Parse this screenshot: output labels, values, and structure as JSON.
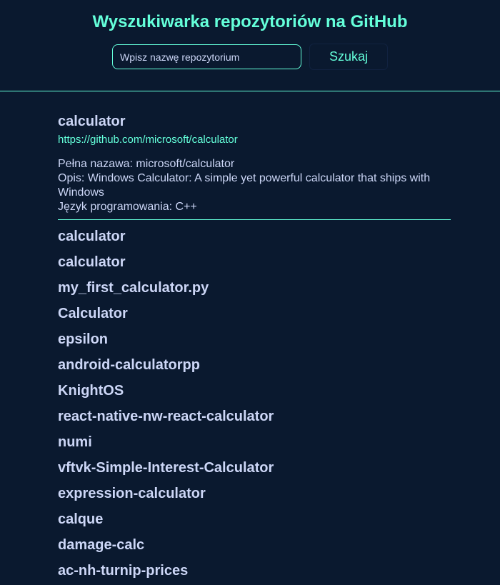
{
  "header": {
    "title": "Wyszukiwarka repozytoriów na GitHub",
    "search_placeholder": "Wpisz nazwę repozytorium",
    "search_button": "Szukaj"
  },
  "expanded_repo": {
    "name": "calculator",
    "url": "https://github.com/microsoft/calculator",
    "full_name": "Pełna nazawa: microsoft/calculator",
    "description": "Opis: Windows Calculator: A simple yet powerful calculator that ships with Windows",
    "language": "Język programowania: C++"
  },
  "repos": [
    "calculator",
    "calculator",
    "my_first_calculator.py",
    "Calculator",
    "epsilon",
    "android-calculatorpp",
    "KnightOS",
    "react-native-nw-react-calculator",
    "numi",
    "vftvk-Simple-Interest-Calculator",
    "expression-calculator",
    "calque",
    "damage-calc",
    "ac-nh-turnip-prices"
  ],
  "colors": {
    "background": "#0a192f",
    "accent": "#64ffda",
    "text": "#ccd6f6"
  }
}
